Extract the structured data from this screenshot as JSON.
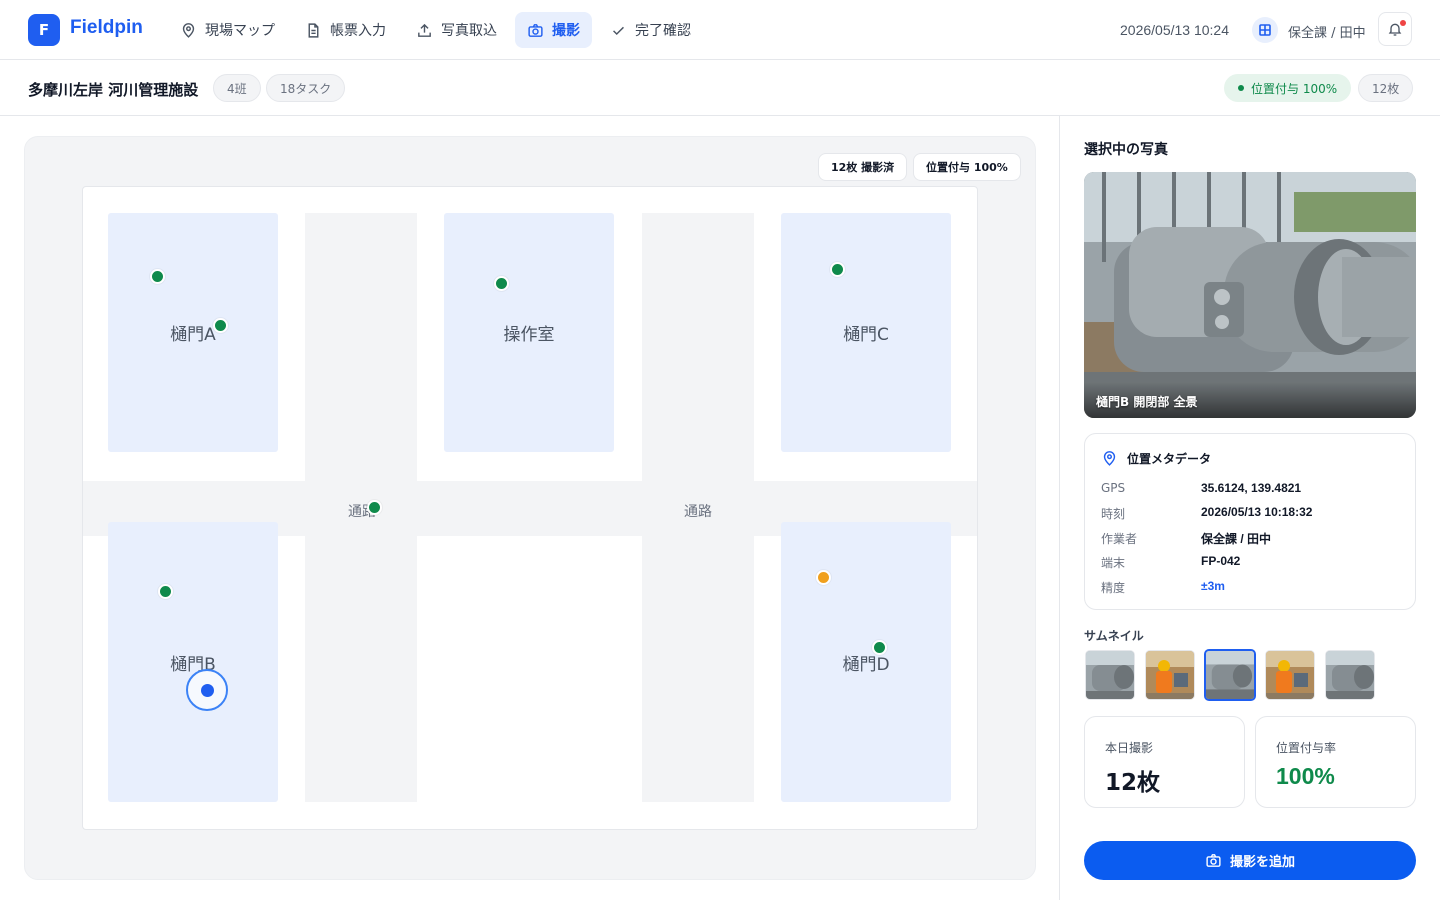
{
  "app": {
    "name": "Fieldpin",
    "logo_letter": "F"
  },
  "nav": {
    "items": [
      {
        "label": "現場マップ",
        "icon": "map-pin-icon"
      },
      {
        "label": "帳票入力",
        "icon": "document-icon"
      },
      {
        "label": "写真取込",
        "icon": "upload-icon"
      },
      {
        "label": "撮影",
        "icon": "camera-icon"
      },
      {
        "label": "完了確認",
        "icon": "check-icon"
      }
    ],
    "active_index": 3
  },
  "header": {
    "datetime": "2026/05/13 10:24",
    "team_icon": "grid-icon",
    "user": "保全課 / 田中",
    "bell_icon": "bell-icon"
  },
  "site": {
    "title": "多摩川左岸 河川管理施設",
    "team_count": "4班",
    "task_count": "18タスク",
    "geo_status": "位置付与 100%",
    "photo_count": "12枚"
  },
  "map": {
    "badges": {
      "shot_count": "12枚 撮影済",
      "geo_rate": "位置付与 100%"
    },
    "zones": [
      "樋門A",
      "操作室",
      "樋門C",
      "樋門B",
      "樋門D"
    ],
    "road_labels": [
      "通路",
      "通路"
    ],
    "pin_colors": {
      "ok": "#0f8a4b",
      "warning": "#f0a01e",
      "selected": "#1f5ef0"
    }
  },
  "panel": {
    "title": "選択中の写真",
    "photo_caption": "樋門B 開閉部 全景",
    "meta": {
      "title": "位置メタデータ",
      "rows": [
        {
          "key": "GPS",
          "value": "35.6124, 139.4821"
        },
        {
          "key": "時刻",
          "value": "2026/05/13 10:18:32"
        },
        {
          "key": "作業者",
          "value": "保全課 / 田中"
        },
        {
          "key": "端末",
          "value": "FP-042"
        },
        {
          "key": "精度",
          "value": "±3m"
        }
      ]
    },
    "thumbnails_label": "サムネイル",
    "thumbnails": [
      "gate-machine",
      "worker",
      "gate-machine",
      "worker",
      "gate-machine"
    ],
    "selected_thumbnail": 2,
    "stats": [
      {
        "label": "本日撮影",
        "value": "12枚"
      },
      {
        "label": "位置付与率",
        "value": "100%"
      }
    ],
    "add_button": "撮影を追加"
  },
  "colors": {
    "brand": "#1f5ef0",
    "success": "#0f8a4b",
    "warning": "#f0a01e",
    "zone_fill": "#e8effd"
  }
}
